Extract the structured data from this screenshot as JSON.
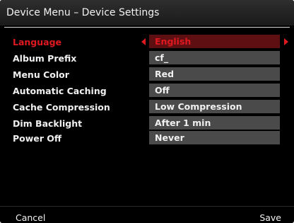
{
  "title": "Device Menu – Device Settings",
  "colors": {
    "accent": "#e01820",
    "selected_value_bg": "#5e0f12",
    "value_bg": "#4a4a4a",
    "background": "#000000",
    "text": "#f0f0f0"
  },
  "settings": [
    {
      "label": "Language",
      "value": "English",
      "selected": true
    },
    {
      "label": "Album Prefix",
      "value": "cf_"
    },
    {
      "label": "Menu Color",
      "value": "Red"
    },
    {
      "label": "Automatic Caching",
      "value": "Off"
    },
    {
      "label": "Cache Compression",
      "value": "Low Compression"
    },
    {
      "label": "Dim Backlight",
      "value": "After 1 min"
    },
    {
      "label": "Power Off",
      "value": "Never"
    }
  ],
  "softkeys": {
    "left": "Cancel",
    "right": "Save"
  },
  "icons": {
    "selector_left": "triangle-left-icon",
    "selector_right": "triangle-right-icon"
  }
}
